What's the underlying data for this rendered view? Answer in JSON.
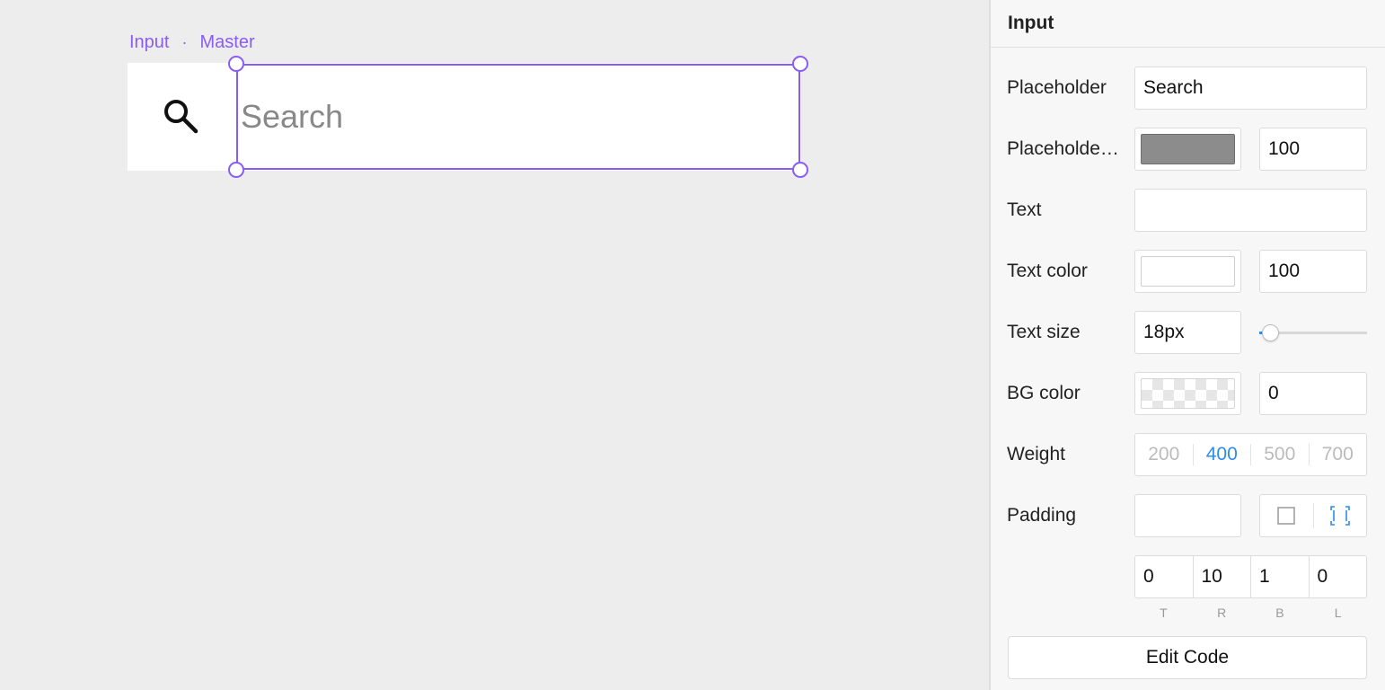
{
  "canvas": {
    "selection_label": {
      "component": "Input",
      "separator": "·",
      "instance": "Master"
    },
    "search_input": {
      "placeholder": "Search"
    },
    "icons": {
      "search": "search-icon"
    }
  },
  "panel": {
    "title": "Input",
    "placeholder": {
      "label": "Placeholder",
      "value": "Search"
    },
    "placeholder_color": {
      "label": "Placeholde…",
      "swatch": "#8c8c8c",
      "opacity": "100"
    },
    "text": {
      "label": "Text",
      "value": ""
    },
    "text_color": {
      "label": "Text color",
      "swatch": "#ffffff",
      "opacity": "100"
    },
    "text_size": {
      "label": "Text size",
      "value": "18px",
      "slider_fraction": 0.1
    },
    "bg_color": {
      "label": "BG color",
      "swatch": "transparent",
      "opacity": "0"
    },
    "weight": {
      "label": "Weight",
      "options": [
        "200",
        "400",
        "500",
        "700"
      ],
      "selected": "400"
    },
    "padding": {
      "label": "Padding",
      "value": "",
      "mode_icons": [
        "uniform-padding-icon",
        "individual-padding-icon"
      ],
      "values": [
        "0",
        "10",
        "1",
        "0"
      ],
      "side_labels": [
        "T",
        "R",
        "B",
        "L"
      ]
    },
    "edit_code_label": "Edit Code"
  },
  "colors": {
    "accent": "#8a5cf6",
    "selected": "#2d8cf0"
  }
}
